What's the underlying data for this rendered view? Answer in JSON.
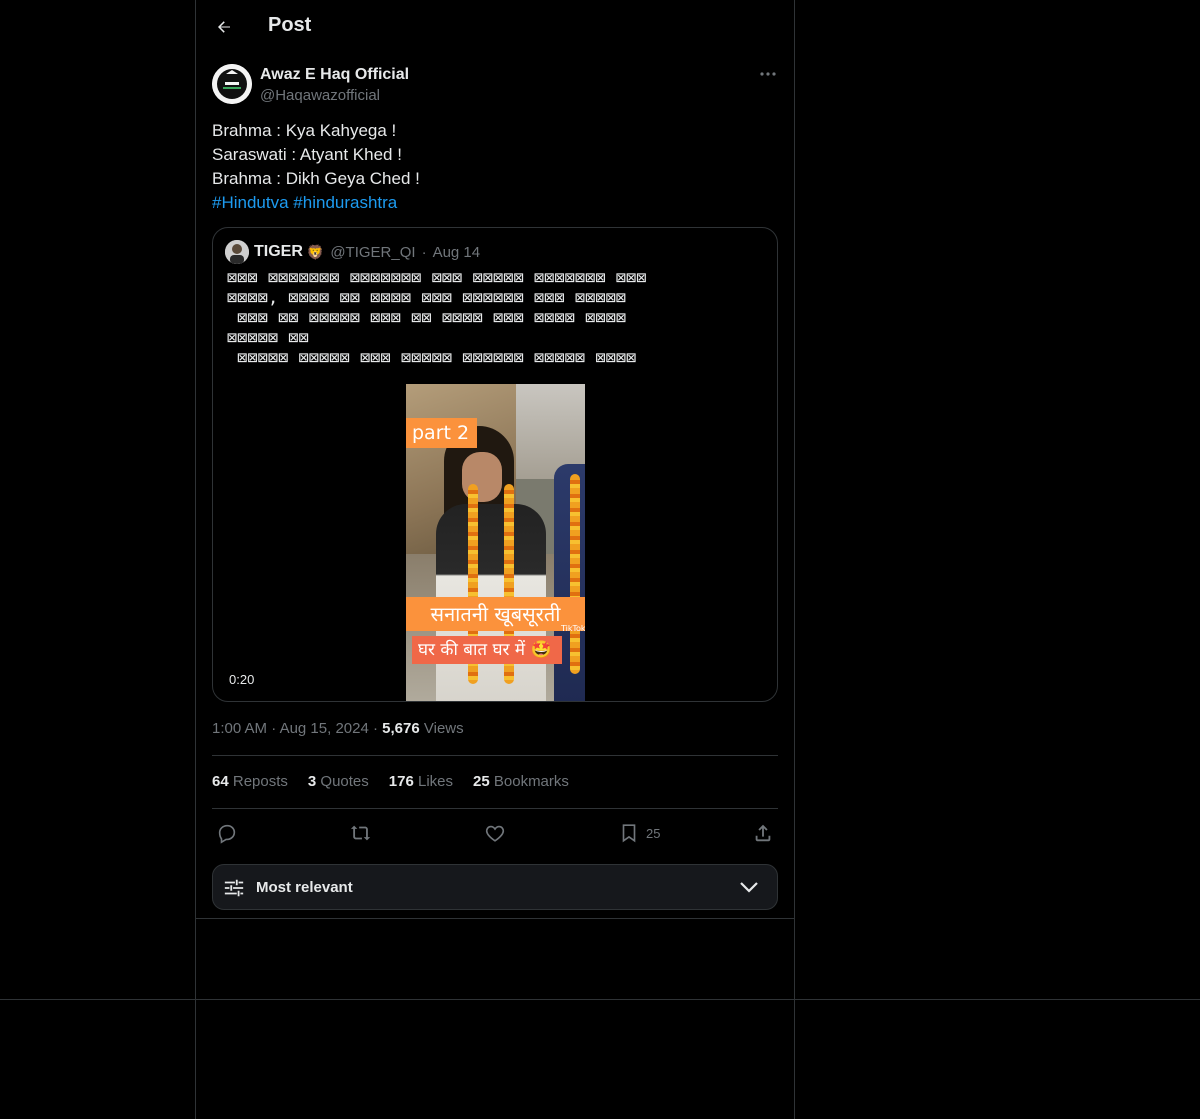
{
  "header": {
    "title": "Post",
    "back_icon": "arrow-left-icon"
  },
  "post": {
    "author_name": "Awaz E Haq Official",
    "author_handle": "@Haqawazofficial",
    "text_lines": [
      "Brahma : Kya Kahyega !",
      "Saraswati : Atyant Khed !",
      "Brahma : Dikh Geya Ched !"
    ],
    "hashtags": [
      "#Hindutva",
      "#hindurashtra"
    ],
    "time": "1:00 AM",
    "date": "Aug 15, 2024",
    "views_count": "5,676",
    "views_label": "Views"
  },
  "quote": {
    "name": "TIGER",
    "emoji": "🦁",
    "handle": "@TIGER_QI",
    "date": "Aug 14",
    "text": "⊠⊠⊠ ⊠⊠⊠⊠⊠⊠⊠ ⊠⊠⊠⊠⊠⊠⊠ ⊠⊠⊠ ⊠⊠⊠⊠⊠ ⊠⊠⊠⊠⊠⊠⊠ ⊠⊠⊠\n⊠⊠⊠⊠, ⊠⊠⊠⊠ ⊠⊠ ⊠⊠⊠⊠ ⊠⊠⊠ ⊠⊠⊠⊠⊠⊠ ⊠⊠⊠ ⊠⊠⊠⊠⊠\n ⊠⊠⊠ ⊠⊠ ⊠⊠⊠⊠⊠ ⊠⊠⊠ ⊠⊠ ⊠⊠⊠⊠ ⊠⊠⊠ ⊠⊠⊠⊠ ⊠⊠⊠⊠\n⊠⊠⊠⊠⊠ ⊠⊠\n ⊠⊠⊠⊠⊠ ⊠⊠⊠⊠⊠ ⊠⊠⊠ ⊠⊠⊠⊠⊠ ⊠⊠⊠⊠⊠⊠ ⊠⊠⊠⊠⊠ ⊠⊠⊠⊠",
    "video": {
      "overlay_part": "part 2",
      "overlay_caption_1": "सनातनी खूबसूरती",
      "overlay_caption_2": "घर की बात घर में 🤩",
      "watermark": "TikTok",
      "duration": "0:20"
    }
  },
  "stats": [
    {
      "count": "64",
      "label": "Reposts"
    },
    {
      "count": "3",
      "label": "Quotes"
    },
    {
      "count": "176",
      "label": "Likes"
    },
    {
      "count": "25",
      "label": "Bookmarks"
    }
  ],
  "actions": {
    "reply_icon": "reply-icon",
    "repost_icon": "repost-icon",
    "like_icon": "heart-icon",
    "bookmark_icon": "bookmark-icon",
    "bookmark_count": "25",
    "share_icon": "share-icon"
  },
  "sort": {
    "label": "Most relevant",
    "icon": "sliders-icon",
    "chevron": "chevron-down-icon"
  },
  "colors": {
    "background": "#000000",
    "text": "#e7e9ea",
    "muted": "#71767b",
    "link": "#1d9bf0",
    "border": "#2f3336"
  }
}
